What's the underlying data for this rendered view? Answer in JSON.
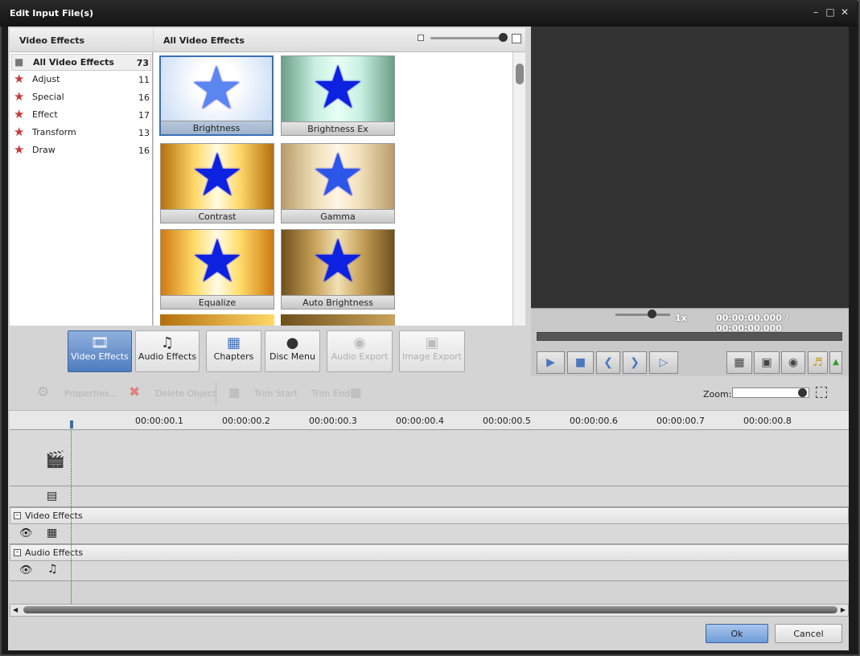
{
  "window": {
    "title": "Edit Input File(s)",
    "min_icon": "minimize-icon",
    "max_icon": "maximize-icon",
    "close_icon": "close-icon"
  },
  "left_panel": {
    "title": "Video Effects",
    "categories": [
      {
        "label": "All Video Effects",
        "count": "73"
      },
      {
        "label": "Adjust",
        "count": "11"
      },
      {
        "label": "Special",
        "count": "16"
      },
      {
        "label": "Effect",
        "count": "17"
      },
      {
        "label": "Transform",
        "count": "13"
      },
      {
        "label": "Draw",
        "count": "16"
      }
    ]
  },
  "effects_panel": {
    "title": "All Video Effects",
    "effects": [
      "Brightness",
      "Brightness Ex",
      "Contrast",
      "Gamma",
      "Equalize",
      "Auto Brightness"
    ]
  },
  "toolbar": {
    "video_effects": "Video Effects",
    "audio_effects": "Audio Effects",
    "chapters": "Chapters",
    "disc_menu": "Disc Menu",
    "audio_export": "Audio Export",
    "image_export": "Image Export"
  },
  "preview": {
    "speed": "1x",
    "time_current": "00:00:00.000",
    "time_separator": "/",
    "time_total": "00:00:00.000"
  },
  "timeline_toolbar": {
    "properties": "Properties...",
    "delete_object": "Delete Object",
    "trim_start": "Trim Start",
    "trim_end": "Trim End",
    "zoom_label": "Zoom:"
  },
  "timeline": {
    "ticks": [
      "00:00:00.1",
      "00:00:00.2",
      "00:00:00.3",
      "00:00:00.4",
      "00:00:00.5",
      "00:00:00.6",
      "00:00:00.7",
      "00:00:00.8"
    ],
    "video_effects_group": "Video Effects",
    "audio_effects_group": "Audio Effects"
  },
  "footer": {
    "ok": "Ok",
    "cancel": "Cancel"
  },
  "colors": {
    "accent": "#4f7cc0",
    "star": "#0c22e0",
    "category_star": "#c8393b"
  }
}
